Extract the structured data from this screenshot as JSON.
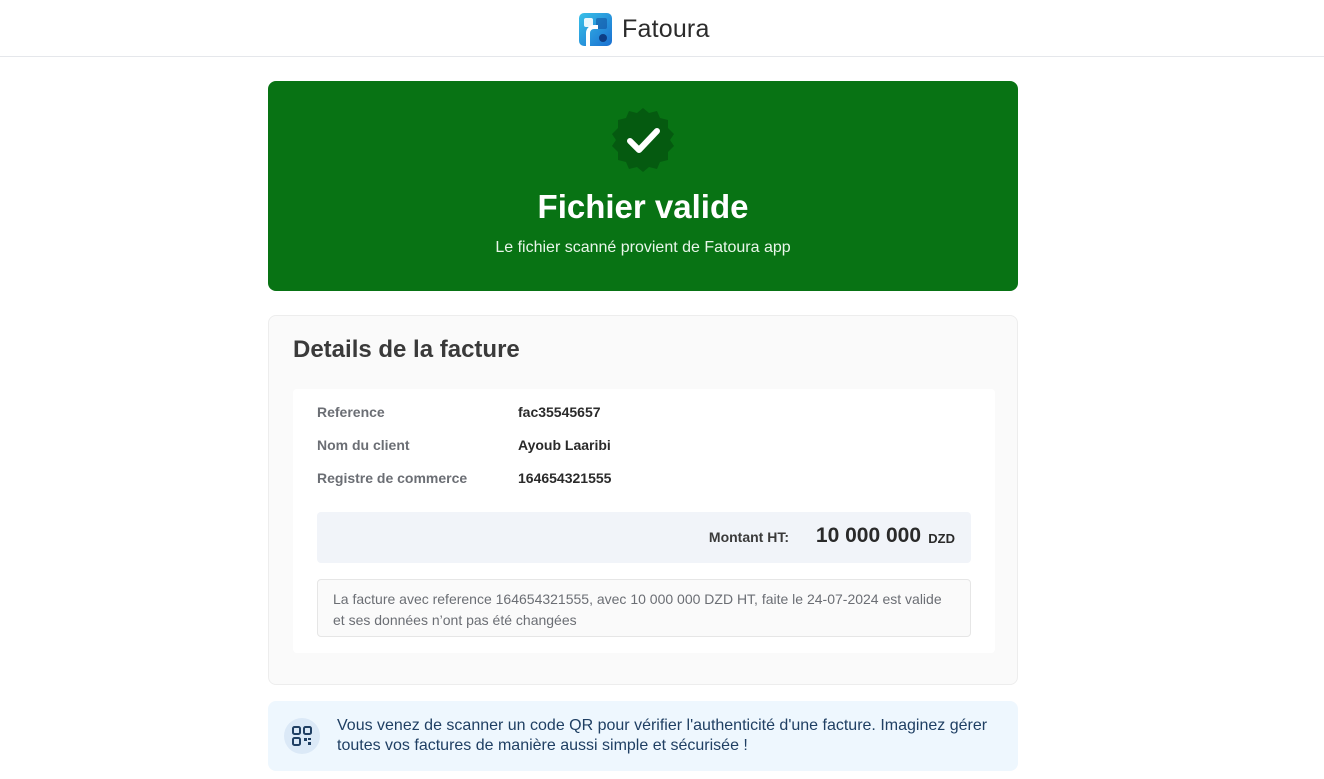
{
  "header": {
    "brand_name": "Fatoura",
    "logo_icon": "fatoura-logo-icon"
  },
  "hero": {
    "icon": "verified-check-badge-icon",
    "title": "Fichier valide",
    "subtitle": "Le fichier scanné provient de Fatoura app",
    "color": "#087314"
  },
  "details": {
    "title": "Details de la facture",
    "rows": [
      {
        "label": "Reference",
        "value": "fac35545657"
      },
      {
        "label": "Nom du client",
        "value": "Ayoub Laaribi"
      },
      {
        "label": "Registre de commerce",
        "value": "164654321555"
      }
    ],
    "amount": {
      "label": "Montant HT:",
      "value": "10 000 000",
      "currency": "DZD"
    },
    "note": "La facture avec reference 164654321555, avec 10 000 000 DZD HT, faite le 24-07-2024 est valide et ses données n’ont pas été changées"
  },
  "promo": {
    "icon": "qr-code-icon",
    "text": "Vous venez de scanner un code QR pour vérifier l'authenticité d'une facture. Imaginez gérer toutes vos factures de manière aussi simple et sécurisée !"
  }
}
